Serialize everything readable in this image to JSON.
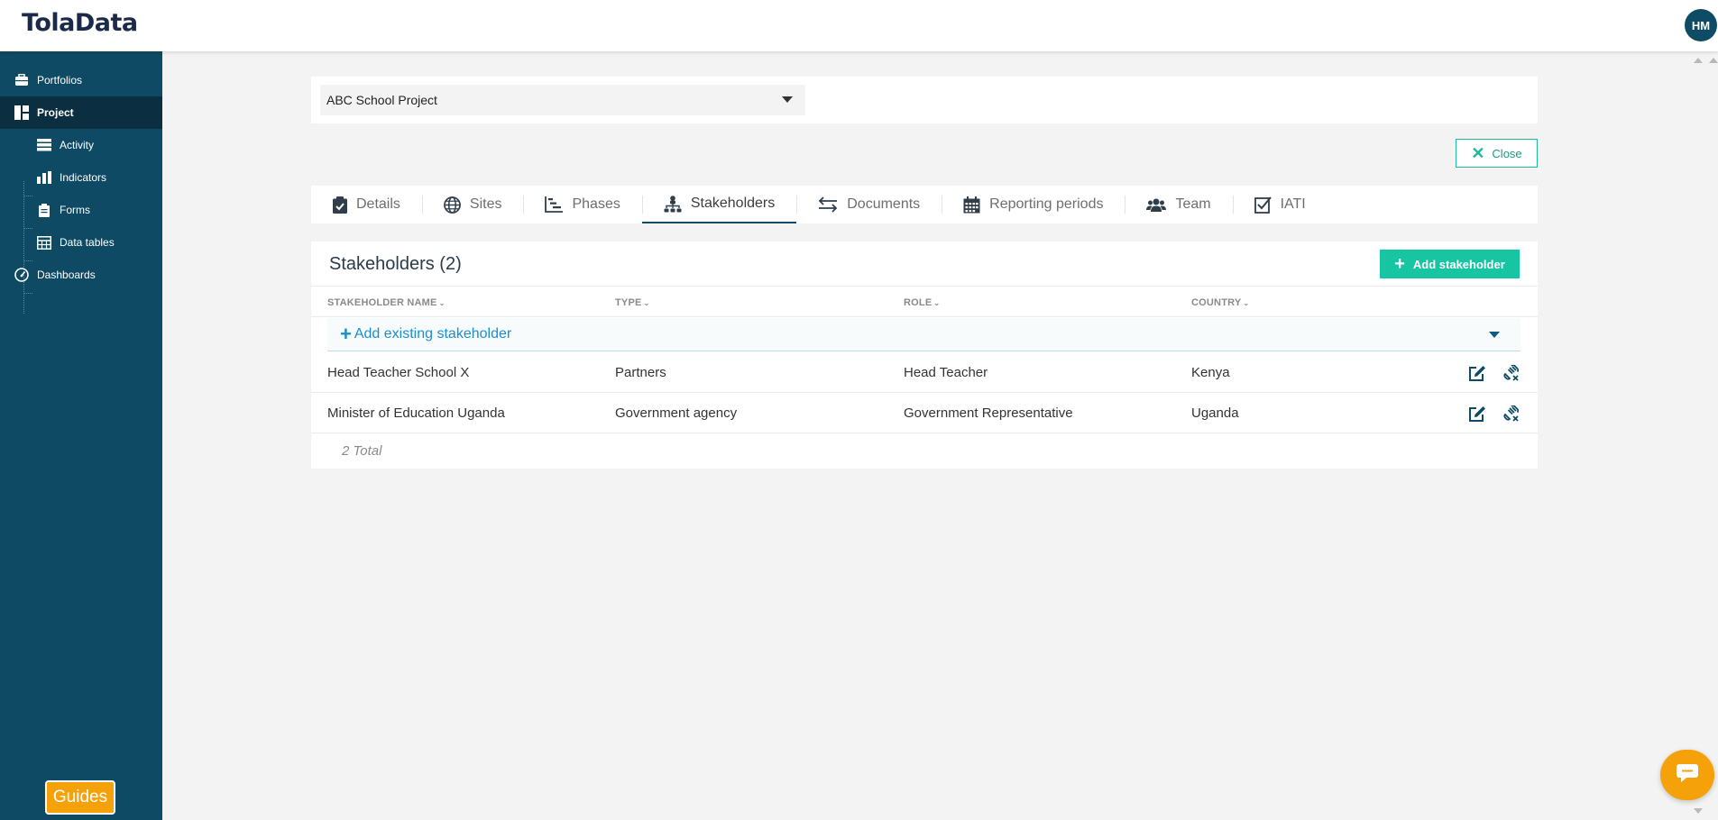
{
  "app": {
    "logo": "TolaData",
    "user_initials": "HM"
  },
  "sidebar": {
    "items": [
      {
        "label": "Portfolios",
        "icon": "briefcase-icon"
      },
      {
        "label": "Project",
        "icon": "project-icon",
        "active": true
      },
      {
        "label": "Activity",
        "icon": "activity-icon"
      },
      {
        "label": "Indicators",
        "icon": "bar-chart-icon"
      },
      {
        "label": "Forms",
        "icon": "clipboard-icon"
      },
      {
        "label": "Data tables",
        "icon": "table-icon"
      },
      {
        "label": "Dashboards",
        "icon": "gauge-icon"
      }
    ],
    "guides_label": "Guides"
  },
  "project_select": {
    "value": "ABC School Project"
  },
  "close_label": "Close",
  "tabs": [
    {
      "label": "Details",
      "icon": "clipboard-check-icon"
    },
    {
      "label": "Sites",
      "icon": "globe-icon"
    },
    {
      "label": "Phases",
      "icon": "phases-chart-icon"
    },
    {
      "label": "Stakeholders",
      "icon": "sitemap-icon",
      "active": true
    },
    {
      "label": "Documents",
      "icon": "exchange-icon"
    },
    {
      "label": "Reporting periods",
      "icon": "calendar-icon"
    },
    {
      "label": "Team",
      "icon": "users-icon"
    },
    {
      "label": "IATI",
      "icon": "check-square-icon"
    }
  ],
  "stakeholders": {
    "title": "Stakeholders (2)",
    "add_button": "Add stakeholder",
    "add_existing": "Add existing stakeholder",
    "columns": [
      "STAKEHOLDER NAME",
      "TYPE",
      "ROLE",
      "COUNTRY"
    ],
    "rows": [
      {
        "name": "Head Teacher School X",
        "type": "Partners",
        "role": "Head Teacher",
        "country": "Kenya"
      },
      {
        "name": "Minister of Education Uganda",
        "type": "Government agency",
        "role": "Government Representative",
        "country": "Uganda"
      }
    ],
    "total": "2 Total"
  },
  "colors": {
    "sidebar": "#0e4a63",
    "accent": "#17c5a2",
    "guides": "#f5a10a",
    "link": "#1d8dcf"
  }
}
